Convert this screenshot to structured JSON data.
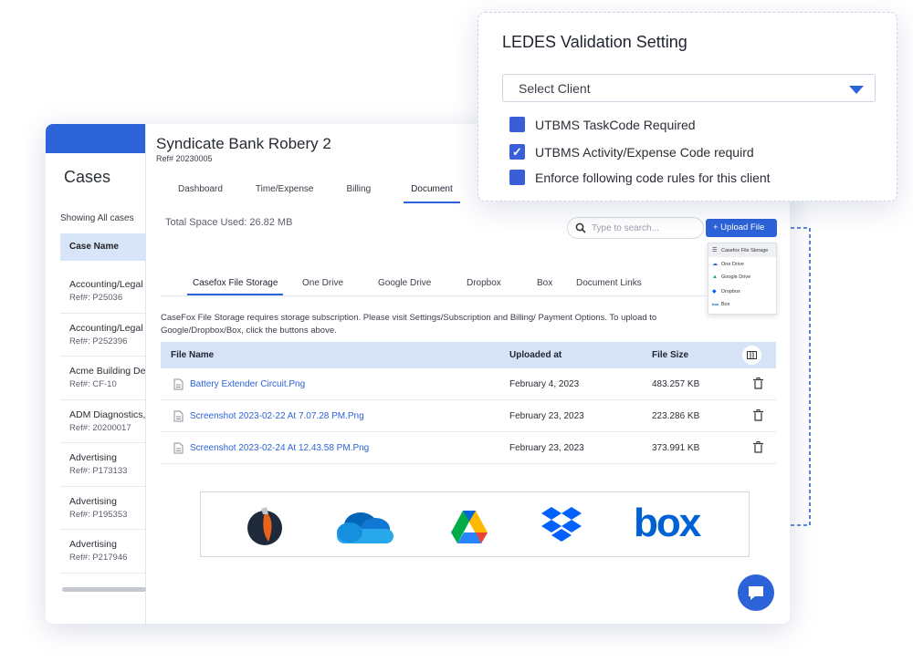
{
  "sidebar": {
    "title": "Cases",
    "showing": "Showing All cases",
    "column_header": "Case Name",
    "items": [
      {
        "name": "Accounting/Legal",
        "ref": "Ref#: P25036"
      },
      {
        "name": "Accounting/Legal",
        "ref": "Ref#: P252396"
      },
      {
        "name": "Acme Building De",
        "ref": "Ref#: CF-10"
      },
      {
        "name": "ADM Diagnostics,",
        "ref": "Ref#: 20200017"
      },
      {
        "name": "Advertising",
        "ref": "Ref#: P173133"
      },
      {
        "name": "Advertising",
        "ref": "Ref#: P195353"
      },
      {
        "name": "Advertising",
        "ref": "Ref#: P217946"
      }
    ]
  },
  "case": {
    "title": "Syndicate Bank Robery 2",
    "ref": "Ref# 20230005"
  },
  "tabs": [
    "Dashboard",
    "Time/Expense",
    "Billing",
    "Document"
  ],
  "active_tab": "Document",
  "total_space": "Total Space Used: 26.82 MB",
  "search": {
    "placeholder": "Type to search..."
  },
  "upload": {
    "label": "+ Upload File",
    "menu": [
      "Casefox File Storage",
      "One Drive",
      "Google Drive",
      "Dropbox",
      "Box"
    ]
  },
  "storage_tabs": [
    "Casefox File Storage",
    "One Drive",
    "Google Drive",
    "Dropbox",
    "Box",
    "Document Links"
  ],
  "notice": "CaseFox File Storage requires storage subscription. Please visit Settings/Subscription and Billing/ Payment Options. To upload to Google/Dropbox/Box, click the buttons above.",
  "table": {
    "headers": {
      "name": "File Name",
      "uploaded": "Uploaded at",
      "size": "File Size"
    },
    "rows": [
      {
        "name": "Battery Extender Circuit.Png",
        "uploaded": "February 4, 2023",
        "size": "483.257 KB"
      },
      {
        "name": "Screenshot 2023-02-22 At 7.07.28 PM.Png",
        "uploaded": "February 23, 2023",
        "size": "223.286 KB"
      },
      {
        "name": "Screenshot 2023-02-24 At 12.43.58 PM.Png",
        "uploaded": "February 23, 2023",
        "size": "373.991 KB"
      }
    ]
  },
  "providers_box_text": "box",
  "ledes": {
    "title": "LEDES Validation Setting",
    "select_value": "Select Client",
    "options": [
      {
        "label": "UTBMS TaskCode Required",
        "checked": false
      },
      {
        "label": "UTBMS Activity/Expense Code requird",
        "checked": true
      },
      {
        "label": "Enforce following code rules for this client",
        "checked": false
      }
    ]
  },
  "colors": {
    "accent": "#2d63d8",
    "header_bg": "#d6e3f7",
    "link": "#2d63d8"
  }
}
